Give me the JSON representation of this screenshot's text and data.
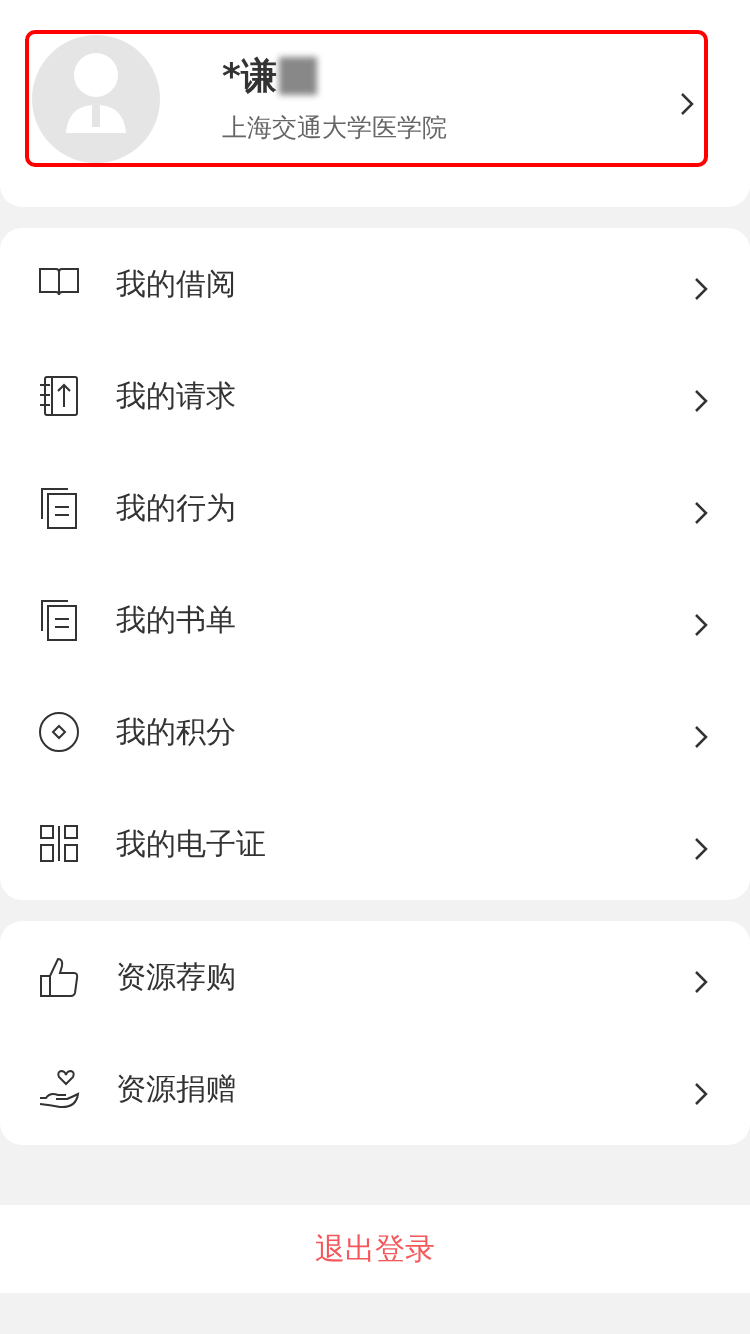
{
  "profile": {
    "name": "*谦",
    "name_redacted": true,
    "affiliation": "上海交通大学医学院",
    "highlighted": true
  },
  "menu_groups": [
    {
      "items": [
        {
          "label": "我的借阅"
        },
        {
          "label": "我的请求"
        },
        {
          "label": "我的行为"
        },
        {
          "label": "我的书单"
        },
        {
          "label": "我的积分"
        },
        {
          "label": "我的电子证"
        }
      ]
    },
    {
      "items": [
        {
          "label": "资源荐购"
        },
        {
          "label": "资源捐赠"
        }
      ]
    }
  ],
  "logout_button": "退出登录"
}
